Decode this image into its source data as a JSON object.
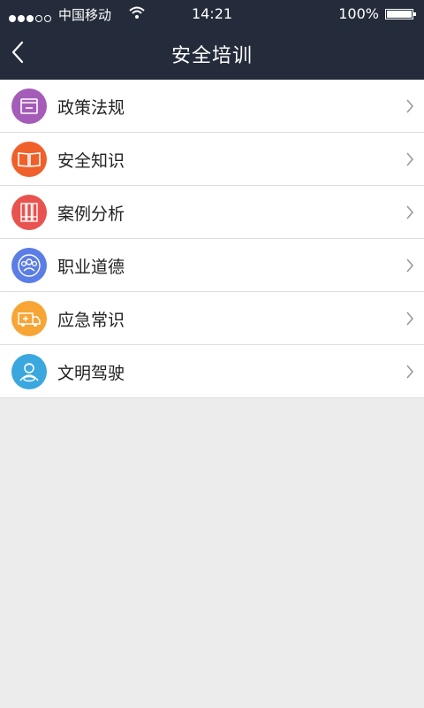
{
  "status": {
    "carrier": "中国移动",
    "time": "14:21",
    "battery": "100%"
  },
  "header": {
    "title": "安全培训"
  },
  "menu": [
    {
      "label": "政策法规",
      "icon": "document-icon",
      "color": "#a45cb8"
    },
    {
      "label": "安全知识",
      "icon": "book-icon",
      "color": "#f0602a"
    },
    {
      "label": "案例分析",
      "icon": "binders-icon",
      "color": "#e9534f"
    },
    {
      "label": "职业道德",
      "icon": "group-icon",
      "color": "#5b7de6"
    },
    {
      "label": "应急常识",
      "icon": "ambulance-icon",
      "color": "#f7a535"
    },
    {
      "label": "文明驾驶",
      "icon": "driver-icon",
      "color": "#3aa7df"
    }
  ],
  "colors": {
    "header_bg": "#242c3b",
    "page_bg": "#ececec"
  }
}
